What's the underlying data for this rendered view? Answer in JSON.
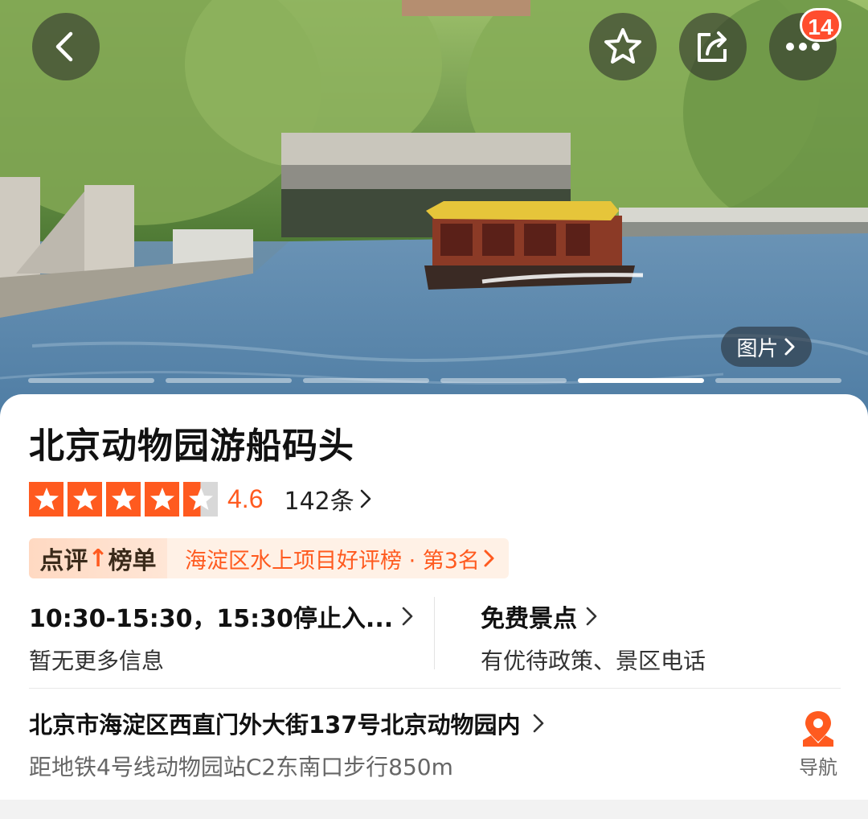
{
  "header": {
    "back_icon": "chevron-left-icon",
    "favorite_icon": "star-outline-icon",
    "share_icon": "share-icon",
    "more_icon": "more-dots-icon",
    "notification_count": "14"
  },
  "gallery": {
    "photos_label": "图片",
    "slide_count": 6,
    "active_index": 4
  },
  "poi": {
    "name": "北京动物园游船码头",
    "rating": {
      "score": "4.6",
      "stars": 4.5,
      "review_count": "142条"
    },
    "ranking": {
      "tag_prefix": "点评",
      "tag_suffix": "榜单",
      "text": "海淀区水上项目好评榜 · 第3名"
    },
    "hours": {
      "main": "10:30-15:30，15:30停止入...",
      "sub": "暂无更多信息"
    },
    "ticket": {
      "main": "免费景点",
      "sub": "有优待政策、景区电话"
    },
    "address": {
      "main": "北京市海淀区西直门外大街137号北京动物园内",
      "metro": "距地铁4号线动物园站C2东南口步行850m"
    },
    "navigation_label": "导航"
  },
  "colors": {
    "accent": "#ff5a1f",
    "badge": "#ff4d2e",
    "rank_background": "#fff1e6"
  }
}
